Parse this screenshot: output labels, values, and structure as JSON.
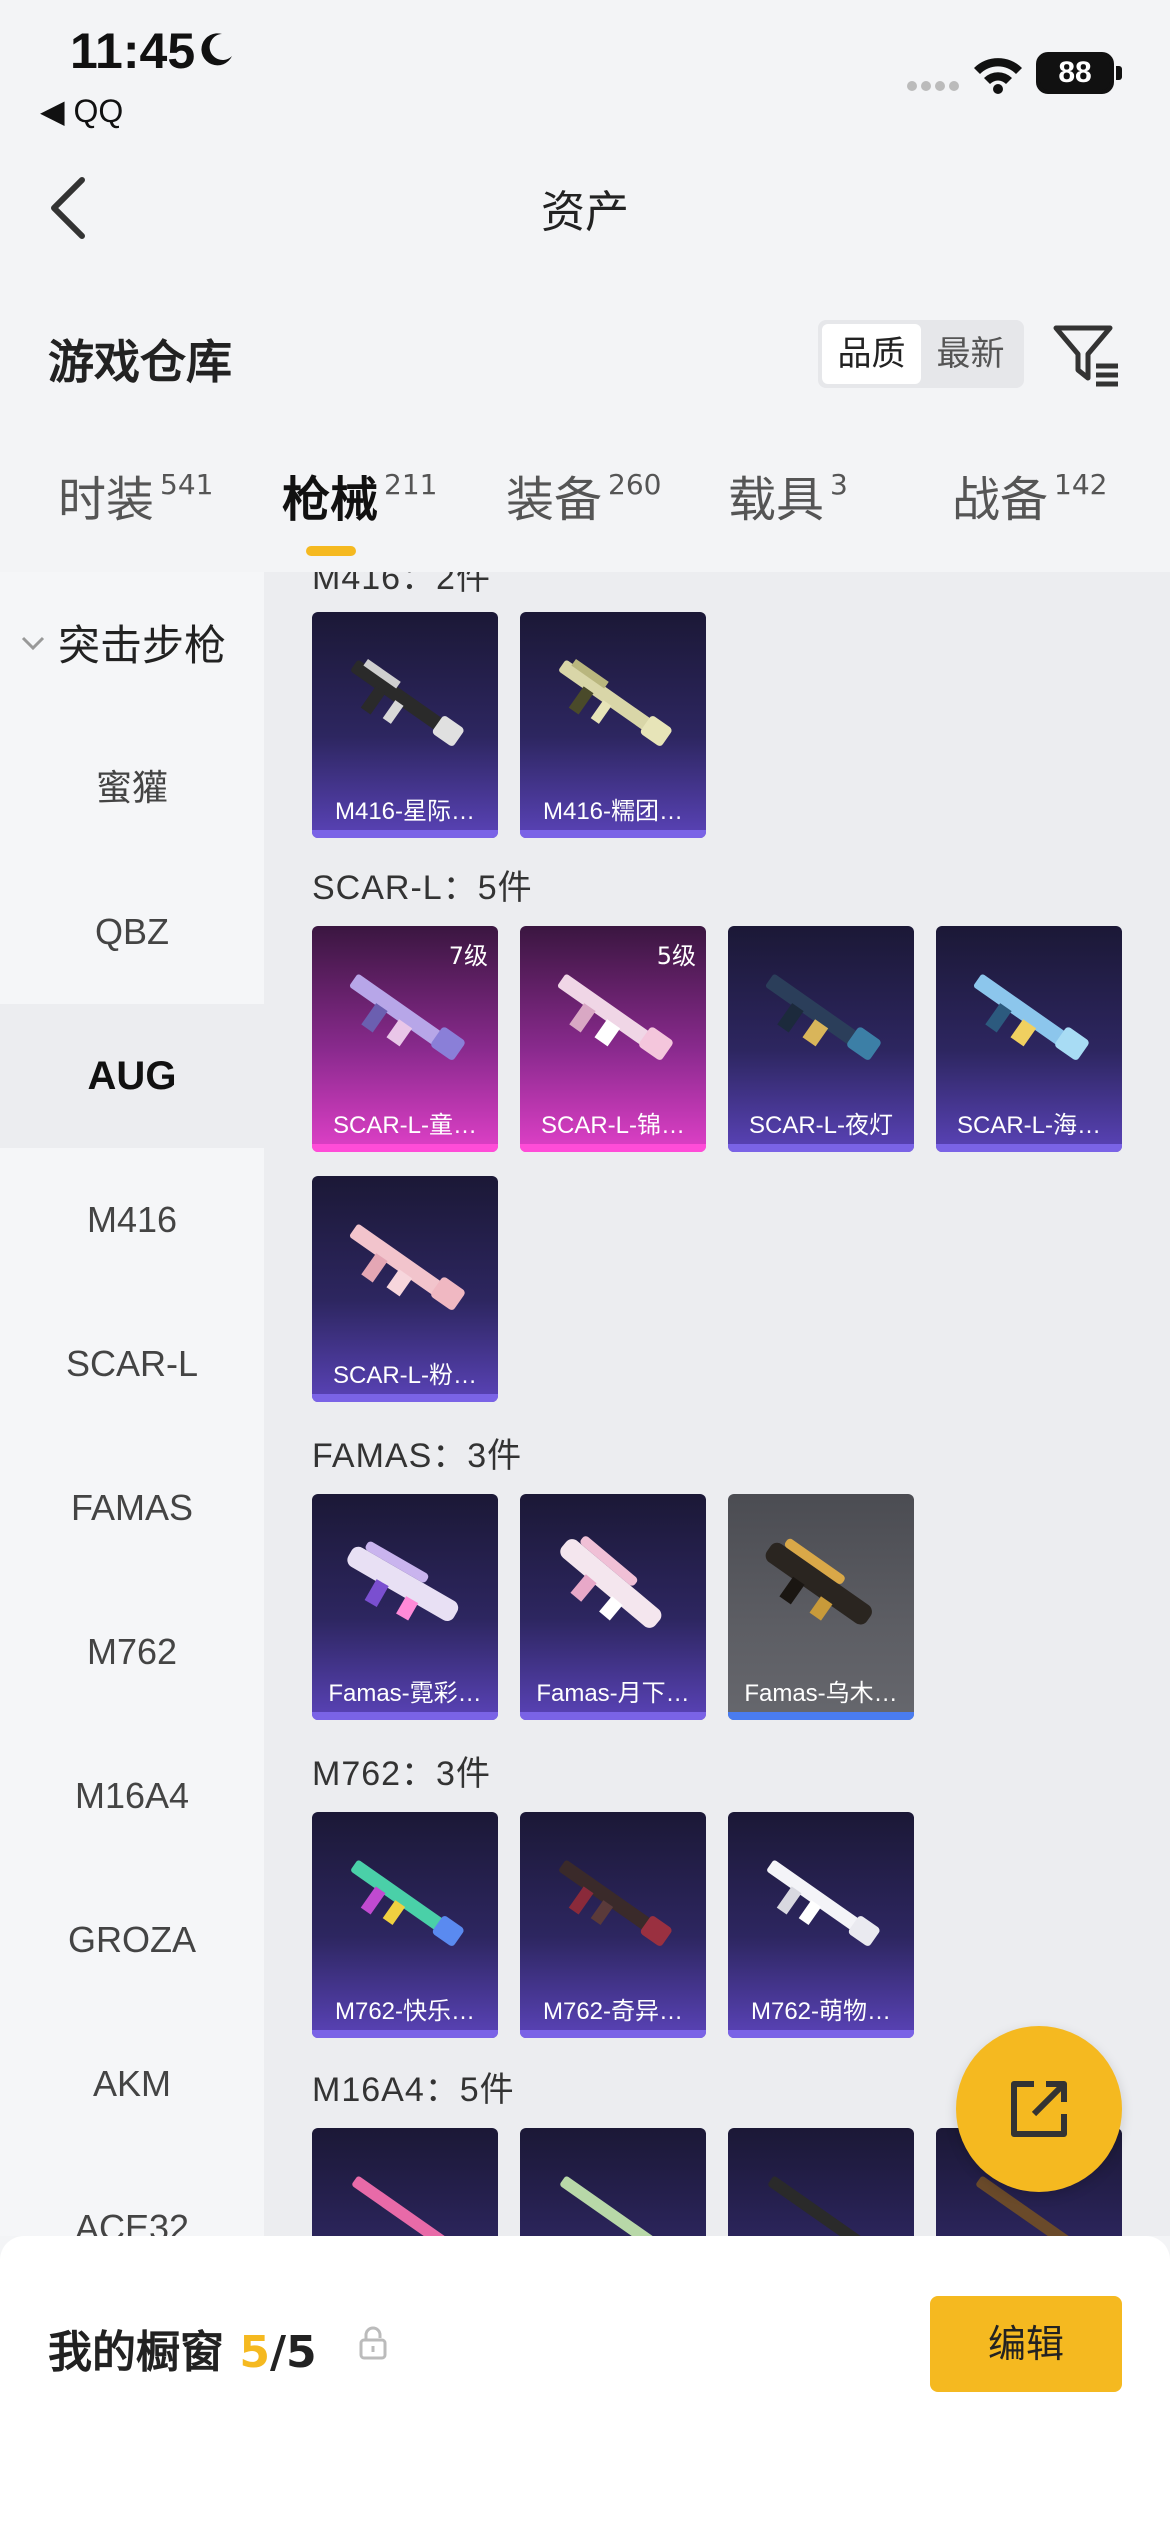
{
  "status_bar": {
    "time": "11:45",
    "back_app": "◀ QQ",
    "battery": "88"
  },
  "nav": {
    "title": "资产"
  },
  "warehouse": {
    "title": "游戏仓库",
    "sort_quality": "品质",
    "sort_latest": "最新"
  },
  "tabs": [
    {
      "label": "时装",
      "count": "541"
    },
    {
      "label": "枪械",
      "count": "211"
    },
    {
      "label": "装备",
      "count": "260"
    },
    {
      "label": "载具",
      "count": "3"
    },
    {
      "label": "战备",
      "count": "142"
    }
  ],
  "sidebar": {
    "category": "突击步枪",
    "items": [
      "蜜獾",
      "QBZ",
      "AUG",
      "M416",
      "SCAR-L",
      "FAMAS",
      "M762",
      "M16A4",
      "GROZA",
      "AKM",
      "ACE32"
    ],
    "active": "AUG"
  },
  "content": {
    "partial_group_title": "M416：2件",
    "groups": [
      {
        "title": "SCAR-L：5件"
      },
      {
        "title": "FAMAS：3件"
      },
      {
        "title": "M762：3件"
      },
      {
        "title": "M16A4：5件"
      }
    ],
    "cards": {
      "m416": [
        "M416-星际…",
        "M416-糯团…"
      ],
      "scar": [
        {
          "label": "SCAR-L-童…",
          "level": "7级"
        },
        {
          "label": "SCAR-L-锦…",
          "level": "5级"
        },
        {
          "label": "SCAR-L-夜灯"
        },
        {
          "label": "SCAR-L-海…"
        },
        {
          "label": "SCAR-L-粉…"
        }
      ],
      "famas": [
        "Famas-霓彩…",
        "Famas-月下…",
        "Famas-乌木…"
      ],
      "m762": [
        "M762-快乐…",
        "M762-奇异…",
        "M762-萌物…"
      ]
    }
  },
  "bottom": {
    "showcase_label": "我的橱窗",
    "count_current": "5",
    "count_total": "/5",
    "edit_label": "编辑"
  },
  "colors": {
    "accent": "#f5b920",
    "rare_purple": "#7a63e6",
    "legendary_pink": "#ff4cd8"
  }
}
